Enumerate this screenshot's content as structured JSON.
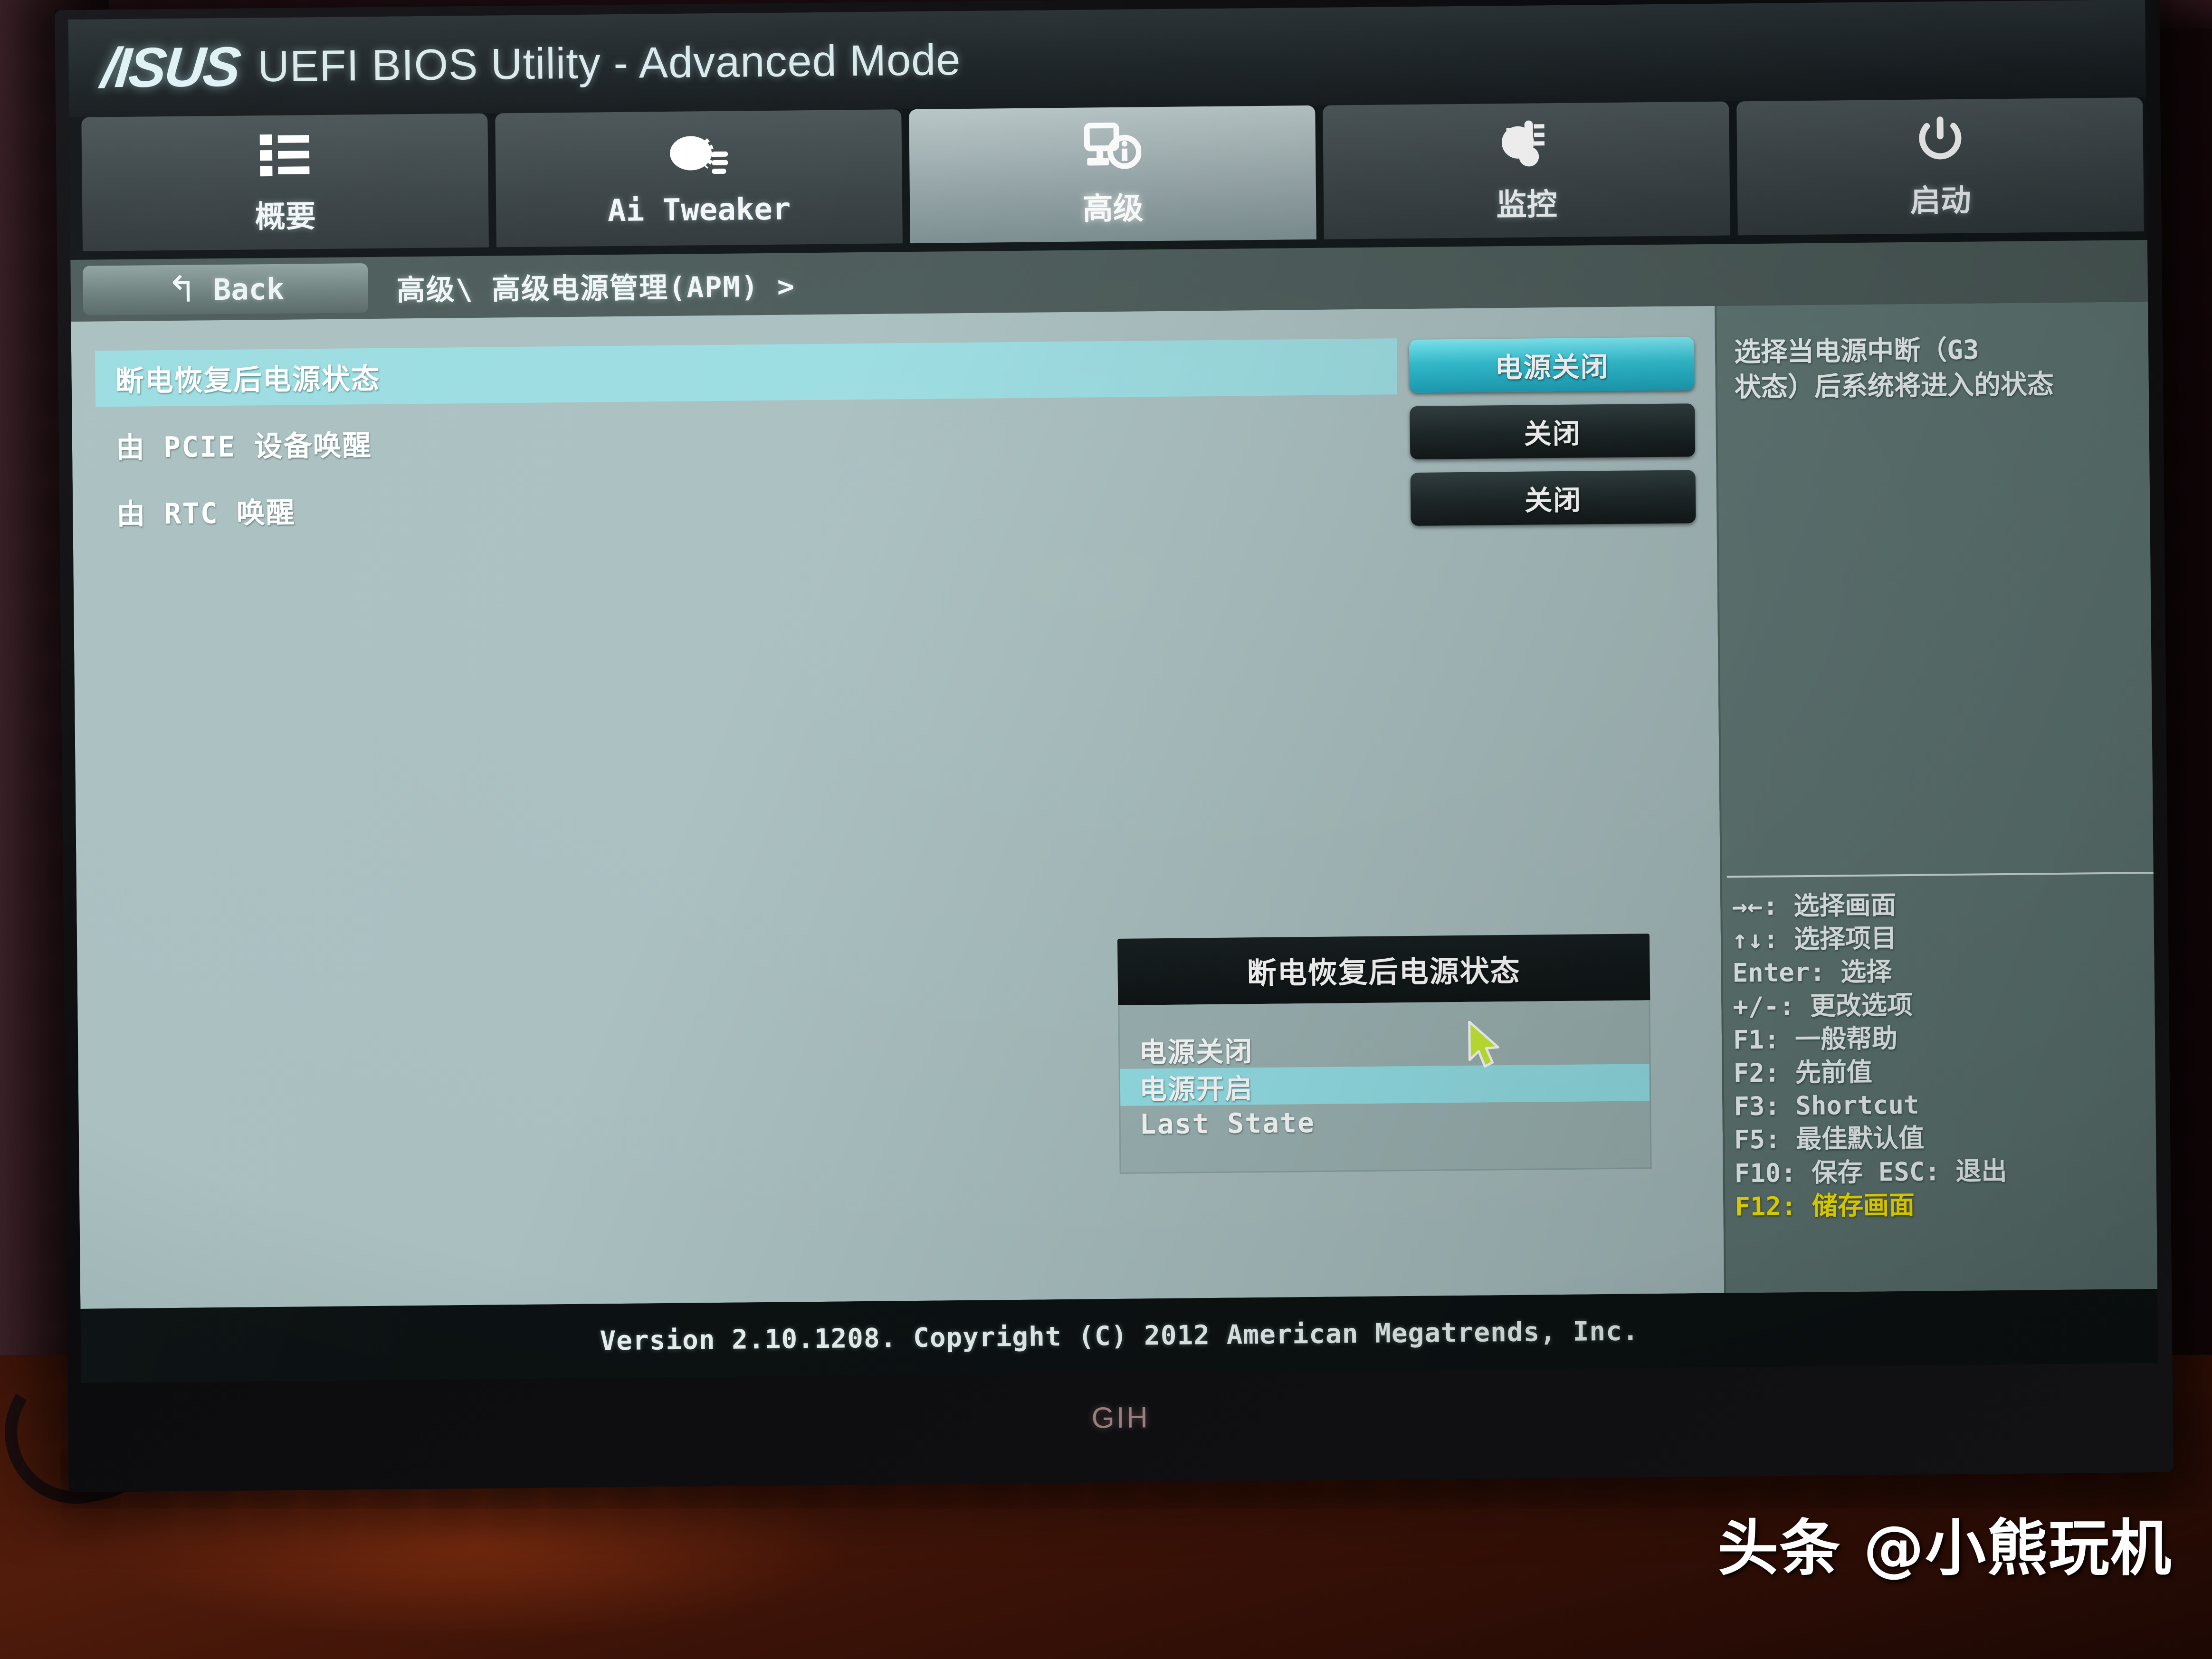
{
  "header": {
    "brand": "/ISUS",
    "title": "UEFI BIOS Utility - Advanced Mode"
  },
  "tabs": [
    {
      "label": "概要",
      "icon": "list-icon",
      "active": false
    },
    {
      "label": "Ai Tweaker",
      "icon": "tuning-knob-icon",
      "active": false
    },
    {
      "label": "高级",
      "icon": "monitor-info-icon",
      "active": true
    },
    {
      "label": "监控",
      "icon": "thermometer-icon",
      "active": false
    },
    {
      "label": "启动",
      "icon": "power-icon",
      "active": false
    }
  ],
  "nav": {
    "back_label": "Back",
    "back_arrow": "↰",
    "breadcrumb": "高级\\ 高级电源管理(APM) >"
  },
  "settings": [
    {
      "label": "断电恢复后电源状态",
      "value": "电源关闭",
      "selected": true
    },
    {
      "label": "由 PCIE 设备唤醒",
      "value": "关闭",
      "selected": false
    },
    {
      "label": "由 RTC 唤醒",
      "value": "关闭",
      "selected": false
    }
  ],
  "dialog": {
    "title": "断电恢复后电源状态",
    "options": [
      {
        "label": "电源关闭",
        "selected": false
      },
      {
        "label": "电源开启",
        "selected": true
      },
      {
        "label": "Last State",
        "selected": false
      }
    ]
  },
  "help": {
    "line1": "选择当电源中断（G3",
    "line2": "状态）后系统将进入的状态"
  },
  "keys": [
    {
      "text": "→←: 选择画面",
      "highlight": false
    },
    {
      "text": "↑↓: 选择项目",
      "highlight": false
    },
    {
      "text": "Enter: 选择",
      "highlight": false
    },
    {
      "text": "+/-: 更改选项",
      "highlight": false
    },
    {
      "text": "F1: 一般帮助",
      "highlight": false
    },
    {
      "text": "F2: 先前值",
      "highlight": false
    },
    {
      "text": "F3: Shortcut",
      "highlight": false
    },
    {
      "text": "F5: 最佳默认值",
      "highlight": false
    },
    {
      "text": "F10: 保存  ESC: 退出",
      "highlight": false
    },
    {
      "text": "F12: 储存画面",
      "highlight": true
    }
  ],
  "footer": {
    "version": "Version 2.10.1208. Copyright (C) 2012 American Megatrends, Inc."
  },
  "monitor": {
    "bezel_logo": "GIH"
  },
  "watermark": {
    "text": "头条 @小熊玩机"
  },
  "colors": {
    "panel_bg": "#a9bfc0",
    "side_bg": "#5f7774",
    "accent_cyan": "#2fc4d8",
    "highlight_row": "#9adde2",
    "key_highlight": "#ffee00"
  }
}
